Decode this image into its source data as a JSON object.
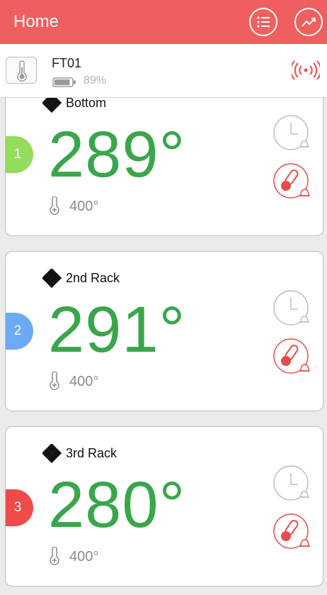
{
  "header": {
    "title": "Home",
    "list_icon": "list-icon",
    "chart_icon": "trend-chart-icon"
  },
  "device": {
    "name": "FT01",
    "battery_pct": "89%",
    "battery_level": 0.89,
    "signal_icon": "wireless-signal-icon"
  },
  "probes": [
    {
      "number": "1",
      "label": "Bottom",
      "temp": "289°",
      "target": "400°",
      "color": "#93dc5c"
    },
    {
      "number": "2",
      "label": "2nd Rack",
      "temp": "291°",
      "target": "400°",
      "color": "#6aaaf6"
    },
    {
      "number": "3",
      "label": "3rd Rack",
      "temp": "280°",
      "target": "400°",
      "color": "#f14a4a"
    }
  ],
  "colors": {
    "header": "#ef5f5f",
    "temp": "#3aa64b",
    "alarm": "#e74c4c"
  }
}
